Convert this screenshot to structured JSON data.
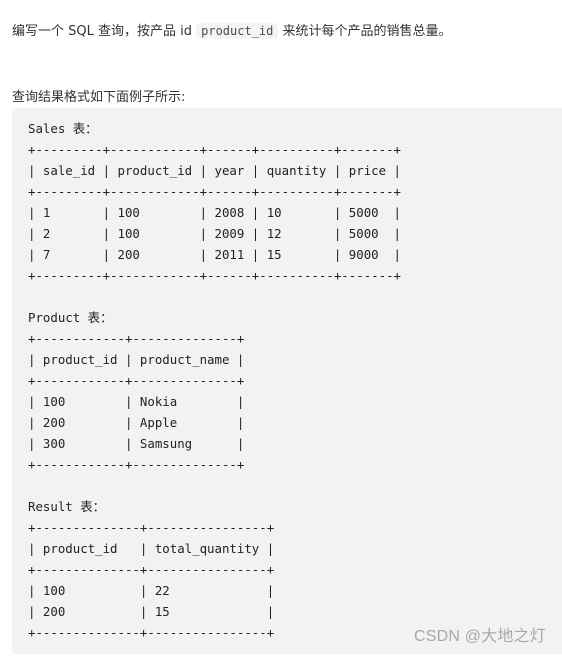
{
  "intro": {
    "before_code": "编写一个 SQL 查询，按产品 id ",
    "inline_code": "product_id",
    "after_code": " 来统计每个产品的销售总量。"
  },
  "format_note": "查询结果格式如下面例子所示:",
  "code_lines": [
    "Sales 表：",
    "+---------+------------+------+----------+-------+",
    "| sale_id | product_id | year | quantity | price |",
    "+---------+------------+------+----------+-------+",
    "| 1       | 100        | 2008 | 10       | 5000  |",
    "| 2       | 100        | 2009 | 12       | 5000  |",
    "| 7       | 200        | 2011 | 15       | 9000  |",
    "+---------+------------+------+----------+-------+",
    "",
    "Product 表：",
    "+------------+--------------+",
    "| product_id | product_name |",
    "+------------+--------------+",
    "| 100        | Nokia        |",
    "| 200        | Apple        |",
    "| 300        | Samsung      |",
    "+------------+--------------+",
    "",
    "Result 表：",
    "+--------------+----------------+",
    "| product_id   | total_quantity |",
    "+--------------+----------------+",
    "| 100          | 22             |",
    "| 200          | 15             |",
    "+--------------+----------------+"
  ],
  "tables": {
    "sales": {
      "title": "Sales 表",
      "columns": [
        "sale_id",
        "product_id",
        "year",
        "quantity",
        "price"
      ],
      "rows": [
        [
          "1",
          "100",
          "2008",
          "10",
          "5000"
        ],
        [
          "2",
          "100",
          "2009",
          "12",
          "5000"
        ],
        [
          "7",
          "200",
          "2011",
          "15",
          "9000"
        ]
      ]
    },
    "product": {
      "title": "Product 表",
      "columns": [
        "product_id",
        "product_name"
      ],
      "rows": [
        [
          "100",
          "Nokia"
        ],
        [
          "200",
          "Apple"
        ],
        [
          "300",
          "Samsung"
        ]
      ]
    },
    "result": {
      "title": "Result 表",
      "columns": [
        "product_id",
        "total_quantity"
      ],
      "rows": [
        [
          "100",
          "22"
        ],
        [
          "200",
          "15"
        ]
      ]
    }
  },
  "watermark": "CSDN @大地之灯"
}
